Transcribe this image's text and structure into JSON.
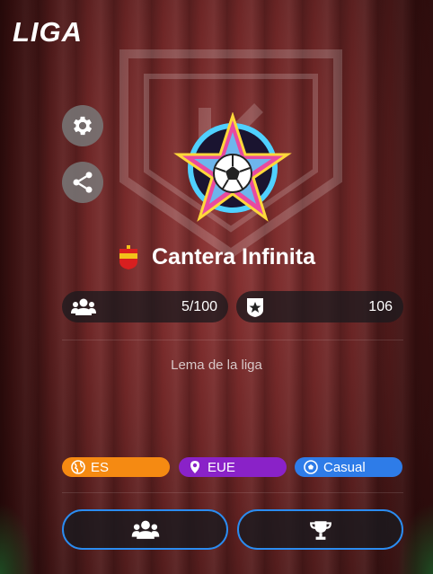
{
  "header": {
    "title": "LIGA"
  },
  "league": {
    "name": "Cantera Infinita",
    "members": "5/100",
    "score": "106",
    "motto": "Lema de la liga"
  },
  "tags": [
    {
      "label": "ES",
      "icon": "globe-icon",
      "color": "#f58a12"
    },
    {
      "label": "EUE",
      "icon": "location-pin-icon",
      "color": "#8a22c8"
    },
    {
      "label": "Casual",
      "icon": "soccer-ball-icon",
      "color": "#2e7ce8"
    }
  ],
  "icons": {
    "settings": "gear-icon",
    "share": "share-icon",
    "members": "users-icon",
    "score": "star-shield-icon",
    "flag": "spain-flag-icon",
    "action_members": "users-icon",
    "action_trophy": "trophy-icon"
  },
  "colors": {
    "accent": "#2b8cf0"
  }
}
